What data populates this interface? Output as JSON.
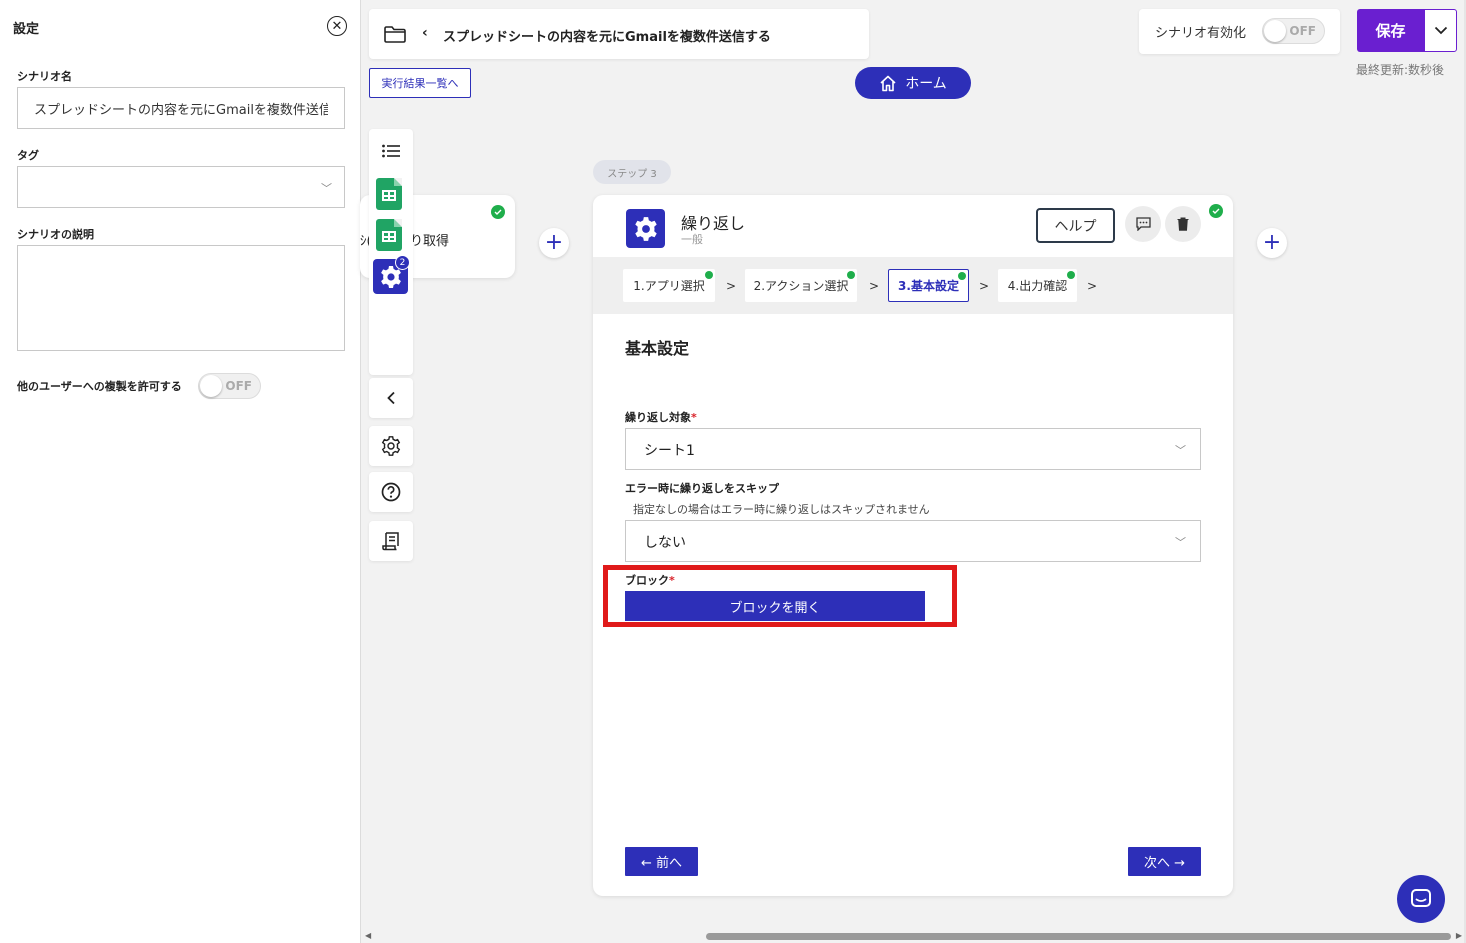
{
  "settings": {
    "header": "設定",
    "scenario_name_label": "シナリオ名",
    "scenario_name_value": "スプレッドシートの内容を元にGmailを複数件送信する",
    "tag_label": "タグ",
    "description_label": "シナリオの説明",
    "description_value": "",
    "allow_copy_label": "他のユーザーへの複製を許可する",
    "allow_copy_toggle": "OFF"
  },
  "topbar": {
    "title": "スプレッドシートの内容を元にGmailを複数件送信する",
    "results_link": "実行結果一覧へ",
    "home_label": "ホーム",
    "scenario_enable_label": "シナリオ有効化",
    "scenario_enable_toggle": "OFF",
    "save_label": "保存",
    "last_update": "最終更新:数秒後"
  },
  "toolbar": {
    "gear_badge": "2"
  },
  "prev_node": {
    "text_left": "ｼ(",
    "text": "り取得"
  },
  "step": {
    "pill": "ステップ 3",
    "title": "繰り返し",
    "subtitle": "一般",
    "help_label": "ヘルプ",
    "tabs": [
      {
        "label": "1.アプリ選択"
      },
      {
        "label": "2.アクション選択"
      },
      {
        "label": "3.基本設定"
      },
      {
        "label": "4.出力確認"
      }
    ],
    "section_title": "基本設定",
    "loop_target_label": "繰り返し対象",
    "loop_target_value": "シート1",
    "skip_label": "エラー時に繰り返しをスキップ",
    "skip_hint": "指定なしの場合はエラー時に繰り返しはスキップされません",
    "skip_value": "しない",
    "block_label": "ブロック",
    "required_mark": "*",
    "open_block_label": "ブロックを開く",
    "prev_label": "← 前へ",
    "next_label": "次へ →"
  },
  "colors": {
    "primary": "#2d2fb8",
    "save": "#6a1fd0",
    "success": "#1fae4b",
    "highlight": "#e01a1a"
  }
}
